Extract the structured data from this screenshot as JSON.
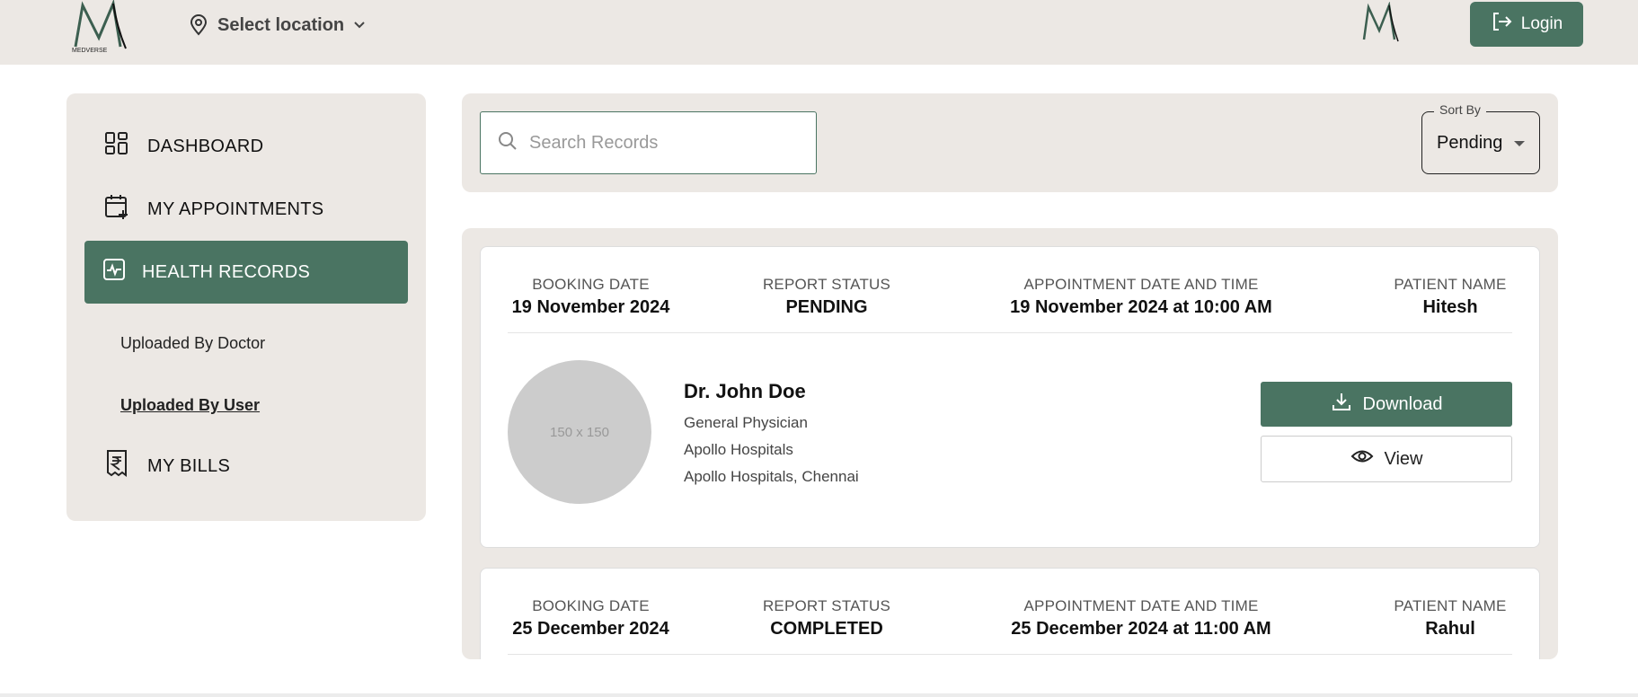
{
  "header": {
    "brand_text": "MEDVERSE",
    "location_label": "Select location",
    "login_label": "Login",
    "accent_color": "#4a7462"
  },
  "sidebar": {
    "items": [
      {
        "label": "DASHBOARD",
        "icon": "dashboard-icon"
      },
      {
        "label": "MY APPOINTMENTS",
        "icon": "calendar-plus-icon"
      },
      {
        "label": "HEALTH RECORDS",
        "icon": "health-record-icon",
        "active": true
      },
      {
        "label": "MY BILLS",
        "icon": "rupee-receipt-icon"
      }
    ],
    "subitems": [
      {
        "label": "Uploaded By Doctor"
      },
      {
        "label": "Uploaded By User",
        "current": true
      }
    ]
  },
  "search": {
    "placeholder": "Search Records",
    "sort_label": "Sort By",
    "sort_value": "Pending"
  },
  "labels": {
    "booking_date": "BOOKING DATE",
    "report_status": "REPORT STATUS",
    "appointment": "APPOINTMENT DATE AND TIME",
    "patient": "PATIENT NAME",
    "download": "Download",
    "view": "View"
  },
  "records": [
    {
      "booking_date": "19 November 2024",
      "report_status": "PENDING",
      "appointment": "19 November 2024 at 10:00 AM",
      "patient": "Hitesh",
      "avatar_text": "150 x 150",
      "doctor": {
        "name": "Dr. John Doe",
        "specialty": "General Physician",
        "hospital": "Apollo Hospitals",
        "address": "Apollo Hospitals, Chennai"
      }
    },
    {
      "booking_date": "25 December 2024",
      "report_status": "COMPLETED",
      "appointment": "25 December 2024 at 11:00 AM",
      "patient": "Rahul"
    }
  ]
}
